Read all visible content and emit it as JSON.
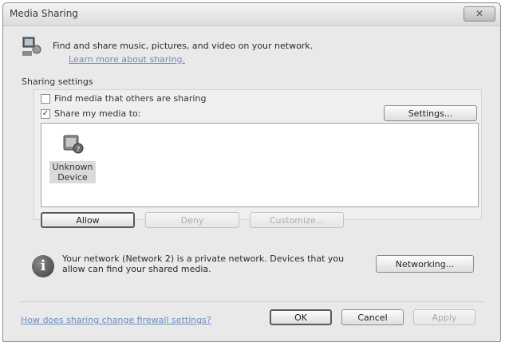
{
  "window": {
    "title": "Media Sharing",
    "close_label": "✕"
  },
  "header": {
    "description": "Find and share music, pictures, and video on your network.",
    "learn_more_link": "Learn more about sharing."
  },
  "sharing_settings": {
    "label": "Sharing settings",
    "find_media": {
      "label": "Find media that others are sharing",
      "checked": false
    },
    "share_media": {
      "label": "Share my media to:",
      "checked": true
    },
    "settings_button": "Settings..."
  },
  "devices": [
    {
      "name_line1": "Unknown",
      "name_line2": "Device",
      "icon": "media-device-icon"
    }
  ],
  "device_actions": {
    "allow": "Allow",
    "deny": "Deny",
    "customize": "Customize..."
  },
  "network_info": {
    "icon": "info-icon",
    "text": "Your network (Network  2) is a private network. Devices that you allow can find your shared media.",
    "networking_button": "Networking..."
  },
  "footer": {
    "firewall_link": "How does sharing change firewall settings?",
    "ok": "OK",
    "cancel": "Cancel",
    "apply": "Apply"
  }
}
